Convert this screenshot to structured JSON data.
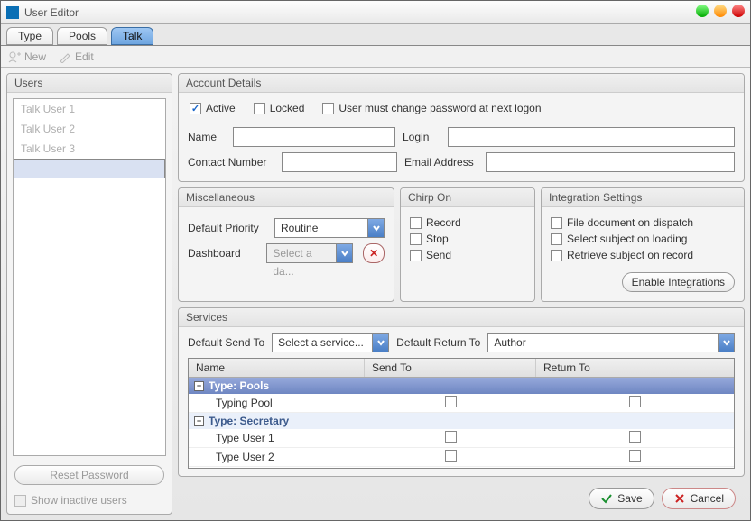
{
  "window": {
    "title": "User Editor"
  },
  "tabs": [
    {
      "label": "Type"
    },
    {
      "label": "Pools"
    },
    {
      "label": "Talk",
      "active": true
    }
  ],
  "toolbar": {
    "new": "New",
    "edit": "Edit"
  },
  "users": {
    "title": "Users",
    "items": [
      {
        "label": "Talk User 1"
      },
      {
        "label": "Talk User 2"
      },
      {
        "label": "Talk User 3"
      }
    ],
    "reset_password": "Reset Password",
    "show_inactive": "Show inactive users"
  },
  "account": {
    "title": "Account Details",
    "active": "Active",
    "locked": "Locked",
    "must_change": "User must change password at next logon",
    "name": "Name",
    "login": "Login",
    "contact": "Contact Number",
    "email": "Email Address"
  },
  "misc": {
    "title": "Miscellaneous",
    "default_priority": "Default Priority",
    "priority_val": "Routine",
    "dashboard": "Dashboard",
    "dashboard_val": "Select a da..."
  },
  "chirp": {
    "title": "Chirp On",
    "record": "Record",
    "stop": "Stop",
    "send": "Send"
  },
  "integ": {
    "title": "Integration Settings",
    "file": "File document on dispatch",
    "select": "Select subject on loading",
    "retrieve": "Retrieve subject on record",
    "enable": "Enable Integrations"
  },
  "services": {
    "title": "Services",
    "default_send_to": "Default Send To",
    "send_to_val": "Select a service...",
    "default_return_to": "Default Return To",
    "return_to_val": "Author",
    "head_name": "Name",
    "head_sendto": "Send To",
    "head_retto": "Return To",
    "group_pools": "Type: Pools",
    "group_secretary": "Type: Secretary",
    "rows_pools": [
      {
        "label": "Typing Pool"
      }
    ],
    "rows_secretary": [
      {
        "label": "Type User 1"
      },
      {
        "label": "Type User 2"
      }
    ]
  },
  "buttons": {
    "save": "Save",
    "cancel": "Cancel"
  }
}
